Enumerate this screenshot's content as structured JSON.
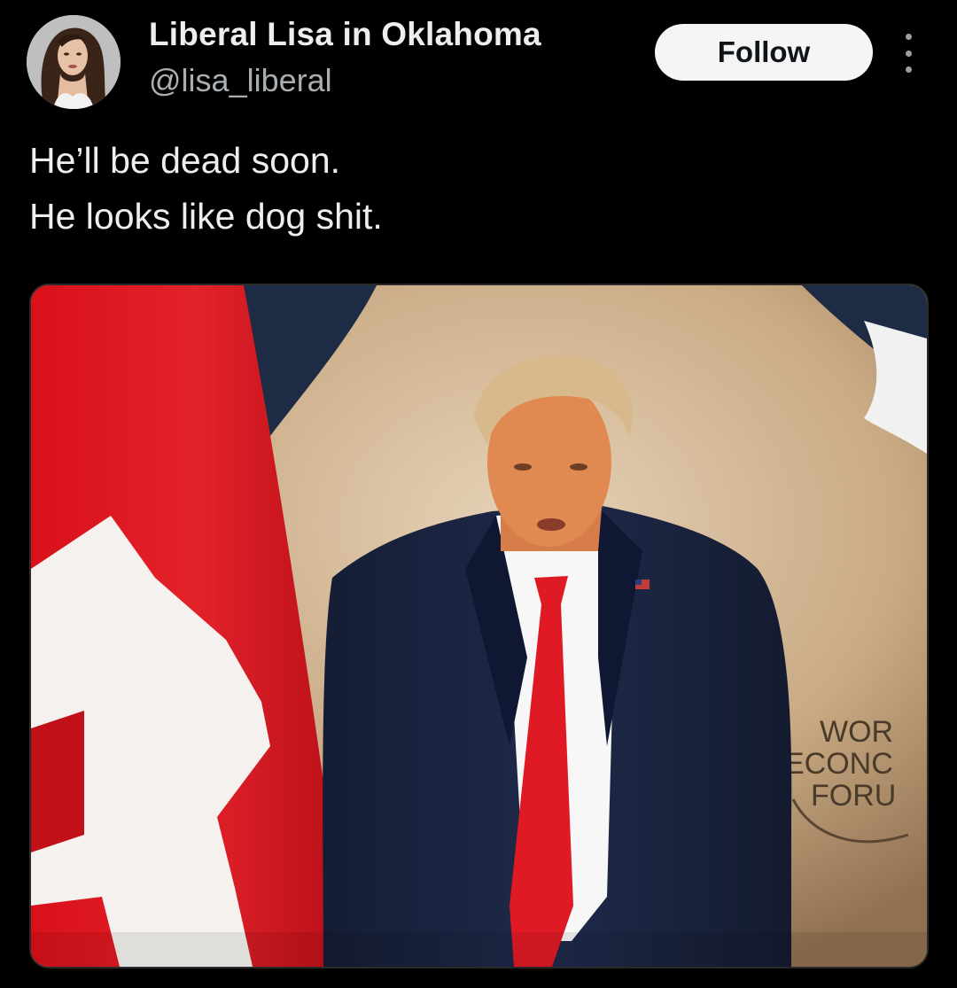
{
  "tweet": {
    "author": {
      "display_name": "Liberal Lisa in Oklahoma",
      "handle": "@lisa_liberal"
    },
    "follow_label": "Follow",
    "text_lines": [
      "He’ll be dead soon.",
      "He looks like dog shit."
    ],
    "media": {
      "backdrop_sign_lines": [
        "WOR",
        "ECONC",
        "FORU"
      ]
    }
  },
  "colors": {
    "background": "#000000",
    "follow_button_bg": "#f5f5f5",
    "follow_button_text": "#0f1419",
    "primary_text": "#eeeeee",
    "secondary_text": "#a9aeb3"
  },
  "icons": {
    "more": "more-vertical-icon"
  }
}
